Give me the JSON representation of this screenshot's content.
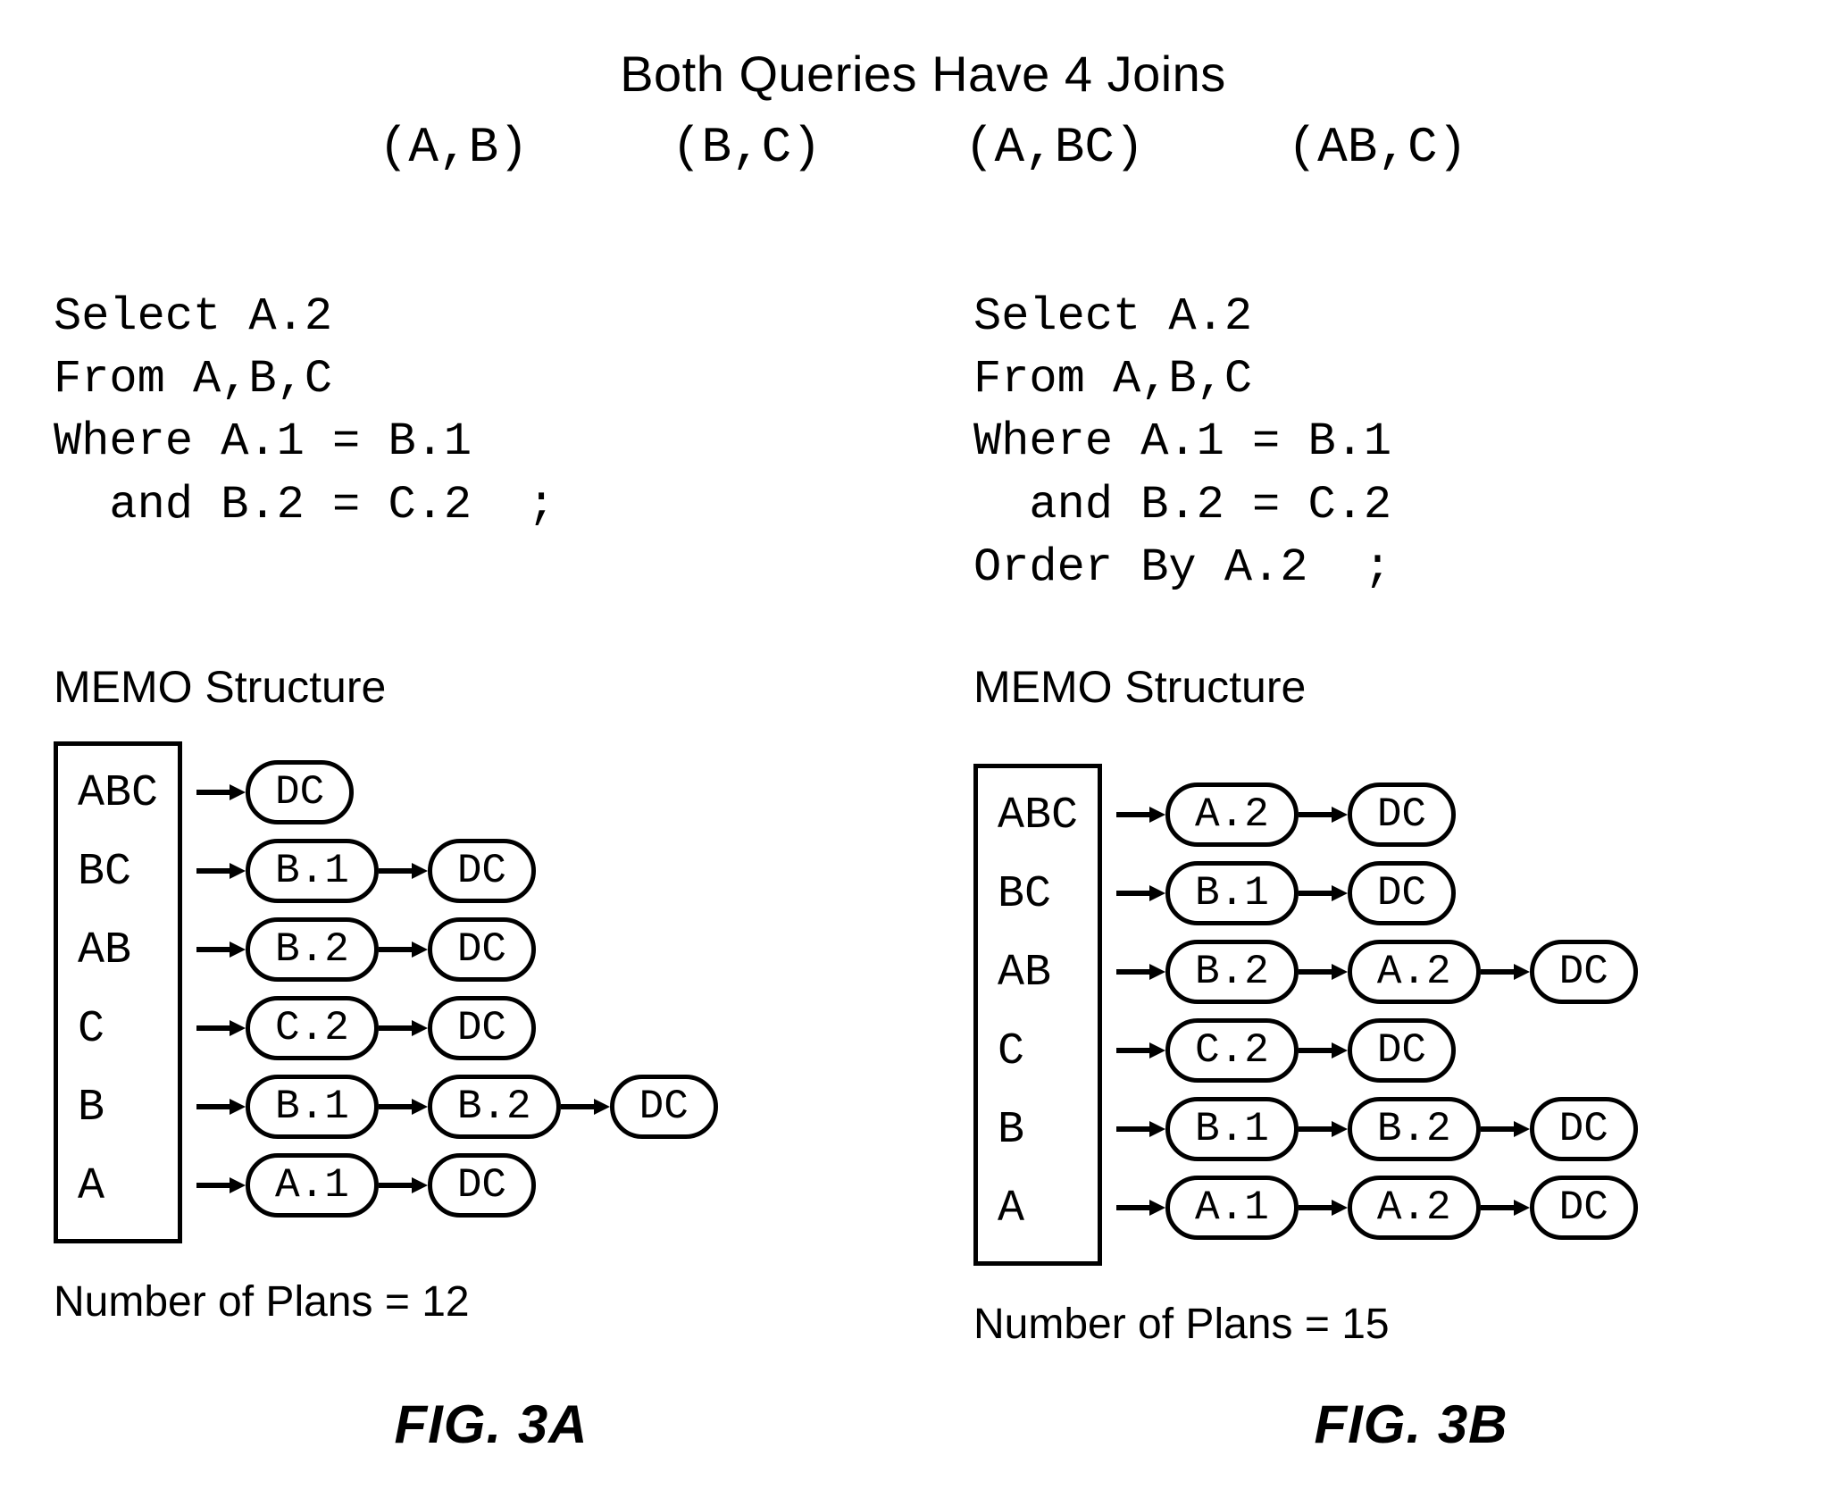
{
  "header": {
    "title": "Both Queries Have 4 Joins",
    "joins": [
      "(A,B)",
      "(B,C)",
      "(A,BC)",
      "(AB,C)"
    ]
  },
  "left": {
    "sql": "Select A.2\nFrom A,B,C\nWhere A.1 = B.1\n  and B.2 = C.2  ;",
    "memo_title": "MEMO Structure",
    "box": [
      "ABC",
      "BC",
      "AB",
      "C",
      "B",
      "A"
    ],
    "chains": [
      [
        "DC"
      ],
      [
        "B.1",
        "DC"
      ],
      [
        "B.2",
        "DC"
      ],
      [
        "C.2",
        "DC"
      ],
      [
        "B.1",
        "B.2",
        "DC"
      ],
      [
        "A.1",
        "DC"
      ]
    ],
    "plans": "Number of Plans = 12",
    "fig": "FIG. 3A"
  },
  "right": {
    "sql": "Select A.2\nFrom A,B,C\nWhere A.1 = B.1\n  and B.2 = C.2\nOrder By A.2  ;",
    "memo_title": "MEMO Structure",
    "box": [
      "ABC",
      "BC",
      "AB",
      "C",
      "B",
      "A"
    ],
    "chains": [
      [
        "A.2",
        "DC"
      ],
      [
        "B.1",
        "DC"
      ],
      [
        "B.2",
        "A.2",
        "DC"
      ],
      [
        "C.2",
        "DC"
      ],
      [
        "B.1",
        "B.2",
        "DC"
      ],
      [
        "A.1",
        "A.2",
        "DC"
      ]
    ],
    "plans": "Number of Plans = 15",
    "fig": "FIG. 3B"
  }
}
